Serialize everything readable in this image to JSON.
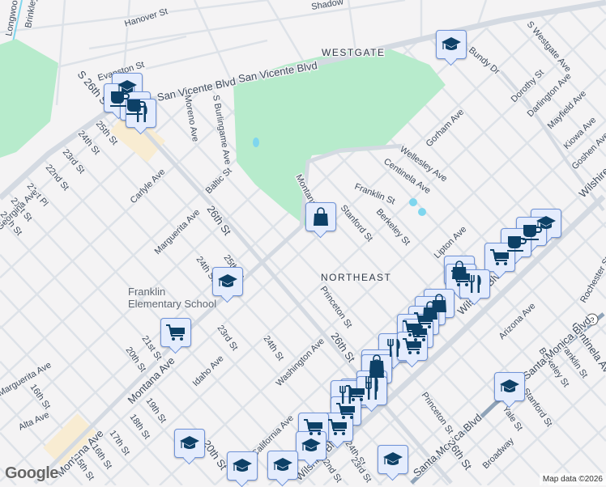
{
  "map": {
    "neighborhoods": {
      "westgate": "WESTGATE",
      "northeast": "NORTHEAST"
    },
    "poi": {
      "school_line1": "Franklin",
      "school_line2": "Elementary School"
    },
    "streets": {
      "hanover": "Hanover St",
      "evanston": "Evanston St",
      "san_vicente_1": "San Vicente Blvd",
      "san_vicente_2": "San Vicente Blvd",
      "s26th": "S 26th St",
      "moreno": "Moreno Ave",
      "s_burlingame": "S Burlingame Ave",
      "th25": "25th St",
      "th24": "24th St",
      "rd23": "23rd St",
      "nd22": "22nd St",
      "st21pl": "21st Pl",
      "st21": "21st St",
      "th20": "20th St",
      "georgina": "Georgina Ave",
      "carlyle": "Carlyle Ave",
      "baltic": "Baltic St",
      "marguerita": "Marguerita Ave",
      "st26": "26th St",
      "montana_1": "Montana Ave",
      "wellesley": "Wellesley Ave",
      "gorham": "Gorham Ave",
      "centinela": "Centinela Ave",
      "franklin": "Franklin St",
      "stanford": "Stanford St",
      "berkeley": "Berkeley St",
      "dorothy": "Dorothy St",
      "darlington": "Darlington Ave",
      "mayfield": "Mayfield Ave",
      "kiowa": "Kiowa Ave",
      "goshen": "Goshen Ave",
      "s_westgate": "S Westgate Ave",
      "bundy": "Bundy Dr",
      "wilshire_1": "Wilshire Blvd",
      "lipton": "Lipton Ave",
      "wilshire_2": "Wilshire Blvd",
      "princeton": "Princeton St",
      "st26_b": "26th St",
      "arizona": "Arizona Ave",
      "rochester": "Rochester St",
      "centinela_2": "Centinela Ave",
      "franklin_2": "Franklin St",
      "berkeley_2": "Berkeley St",
      "stanford_2": "Stanford St",
      "yale": "Yale St",
      "smb_1": "Santa Monica Blvd",
      "smb_2": "Santa Monica Blvd",
      "princeton_2": "Princeton St",
      "st26_c": "26th St",
      "broadway": "Broadway",
      "wilshire_3": "Wilshire Blvd",
      "st24_b": "24th St",
      "rd23_b": "23rd St",
      "nd22_b": "22nd St",
      "california": "California Ave",
      "washington": "Washington Ave",
      "st24_c": "24th St",
      "rd23_c": "23rd St",
      "idaho": "Idaho Ave",
      "st21_b": "21st St",
      "th20_b": "20th St",
      "montana_2": "Montana Ave",
      "th19": "19th St",
      "th18": "18th St",
      "th20_c": "20th St",
      "marguerita_2": "Marguerita Ave",
      "th16": "16th St",
      "alta": "Alta Ave",
      "montana_3": "Montana Ave",
      "th17": "17th St",
      "th16_b": "16th St",
      "th15": "15th St",
      "st24_d": "24th St",
      "st25_b": "25th St",
      "longwood": "Longwood Ave",
      "brinkley": "Brinkley Ave",
      "shadow": "Shadow"
    },
    "highway_shield": "2",
    "logo": "Google",
    "attribution": "Map data ©2026",
    "colors": {
      "park": "#b7ebcc",
      "road": "#d8dee6",
      "highway": "#8fa3b8",
      "marker_bg": "#e4ecfd",
      "marker_border": "#6f93d8",
      "icon": "#0d4066"
    }
  }
}
